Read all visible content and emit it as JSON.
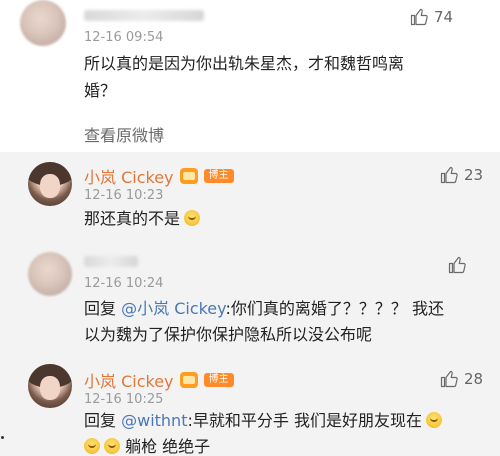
{
  "post": {
    "time": "12-16 09:54",
    "likes": "74",
    "text_line1": "所以真的是因为你出轨朱星杰，才和魏哲鸣离",
    "text_line2": "婚？",
    "view_link": "查看原微博"
  },
  "replies": [
    {
      "username": "小岚 Cickey",
      "badge_text": "博主",
      "time": "12-16 10:23",
      "likes": "23",
      "text": "那还真的不是"
    },
    {
      "time": "12-16 10:24",
      "likes": "",
      "reply_prefix": "回复",
      "mention": "@小岚 Cickey",
      "text_line1_rest": ":你们真的离婚了？？？？ 我还",
      "text_line2": "以为魏为了保护你保护隐私所以没公布呢"
    },
    {
      "username": "小岚 Cickey",
      "badge_text": "博主",
      "time": "12-16 10:25",
      "likes": "28",
      "reply_prefix": "回复",
      "mention": "@withnt",
      "text_line1_rest": ":早就和平分手 我们是好朋友现在",
      "text_line2_rest": "躺枪 绝绝子"
    }
  ]
}
